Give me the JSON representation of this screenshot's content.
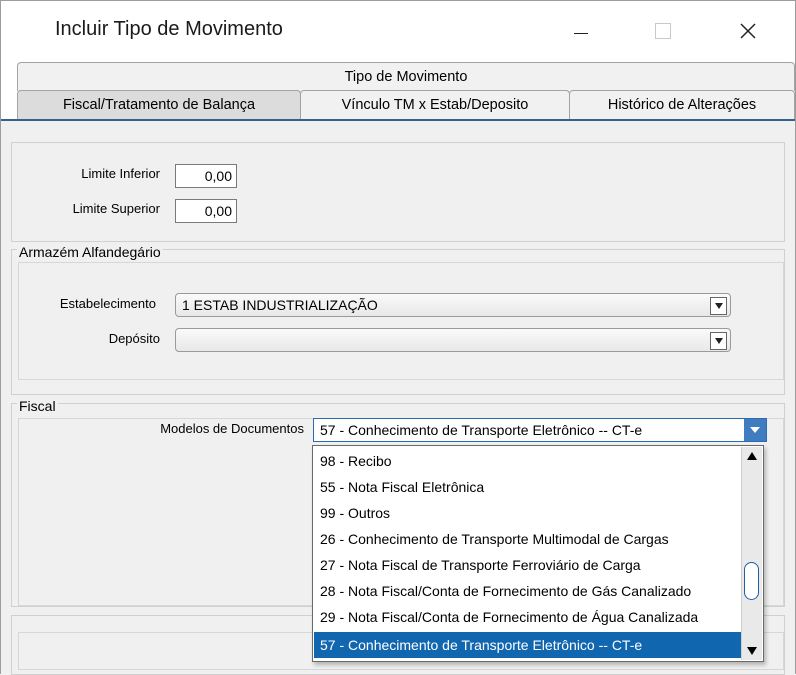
{
  "window": {
    "title": "Incluir Tipo de Movimento"
  },
  "tabs": {
    "row1": [
      "Tipo de Movimento"
    ],
    "row2": [
      "Fiscal/Tratamento de Balança",
      "Vínculo TM x Estab/Deposito",
      "Histórico de Alterações"
    ],
    "active": "Fiscal/Tratamento de Balança"
  },
  "limits": {
    "lower_label": "Limite Inferior",
    "lower_value": "0,00",
    "upper_label": "Limite Superior",
    "upper_value": "0,00"
  },
  "armazem": {
    "legend": "Armazém Alfandegário",
    "estabelecimento_label": "Estabelecimento",
    "estabelecimento_value": "1 ESTAB INDUSTRIALIZAÇÃO",
    "deposito_label": "Depósito",
    "deposito_value": ""
  },
  "fiscal": {
    "legend": "Fiscal",
    "modelos_label": "Modelos de Documentos",
    "modelos_value": "57 - Conhecimento de Transporte Eletrônico -- CT-e",
    "options": [
      "98 - Recibo",
      "55 - Nota Fiscal Eletrônica",
      "99 - Outros",
      "26 - Conhecimento de Transporte Multimodal de Cargas",
      "27 - Nota Fiscal de Transporte Ferroviário de Carga",
      "28 - Nota Fiscal/Conta de Fornecimento de Gás Canalizado",
      "29 - Nota Fiscal/Conta de Fornecimento de Água Canalizada",
      "57 - Conhecimento de Transporte Eletrônico -- CT-e"
    ],
    "selected_index": 7
  },
  "colors": {
    "selection": "#1166b0",
    "tab_underline": "#35618d",
    "panel_bg": "#f0f0f0"
  }
}
